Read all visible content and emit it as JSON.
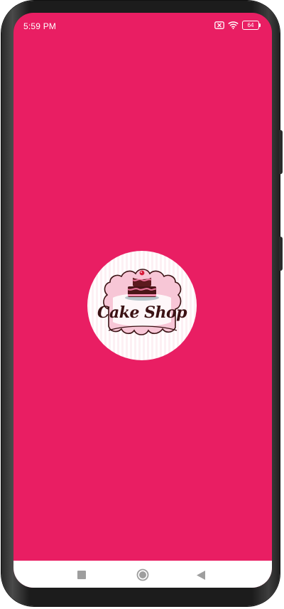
{
  "status_bar": {
    "time": "5:59 PM",
    "icons": [
      "sim-x-icon",
      "wifi-icon",
      "battery-icon"
    ],
    "battery_level": "64"
  },
  "splash": {
    "background_color": "#e91e63",
    "logo": {
      "text": "Cake Shop",
      "icon": "cake-icon",
      "text_color": "#3b1214",
      "accent_color": "#f48fb1"
    }
  },
  "nav_bar": {
    "buttons": [
      "recents-icon",
      "home-icon",
      "back-icon"
    ]
  }
}
